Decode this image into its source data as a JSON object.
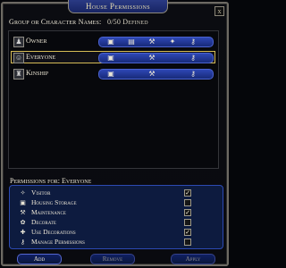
{
  "window": {
    "title": "House Permissions",
    "close_label": "x"
  },
  "header": {
    "label": "Group or Character Names:",
    "defined": "0/50 Defined"
  },
  "groups": [
    {
      "label": "Owner",
      "icon_name": "group-icon",
      "selected": false,
      "icons": [
        "chest-icon",
        "book-icon",
        "hammer-icon",
        "teleport-icon",
        "key-icon"
      ]
    },
    {
      "label": "Everyone",
      "icon_name": "everyone-icon",
      "selected": true,
      "icons": [
        "chest-icon",
        "hammer-icon",
        "key-icon"
      ]
    },
    {
      "label": "Kinship",
      "icon_name": "kinship-icon",
      "selected": false,
      "icons": [
        "chest-icon",
        "hammer-icon",
        "key-icon"
      ]
    }
  ],
  "permissions": {
    "title": "Permissions for: Everyone",
    "items": [
      {
        "label": "Visitor",
        "checked": "✓",
        "icon": "visitor-icon"
      },
      {
        "label": "Housing Storage",
        "checked": "",
        "icon": "storage-icon"
      },
      {
        "label": "Maintenance",
        "checked": "✓",
        "icon": "maintenance-icon"
      },
      {
        "label": "Decorate",
        "checked": "",
        "icon": "decorate-icon"
      },
      {
        "label": "Use Decorations",
        "checked": "✓",
        "icon": "use-decorations-icon"
      },
      {
        "label": "Manage Permissions",
        "checked": "",
        "icon": "manage-permissions-icon"
      }
    ]
  },
  "buttons": {
    "add": "Add",
    "remove": "Remove",
    "apply": "Apply"
  }
}
